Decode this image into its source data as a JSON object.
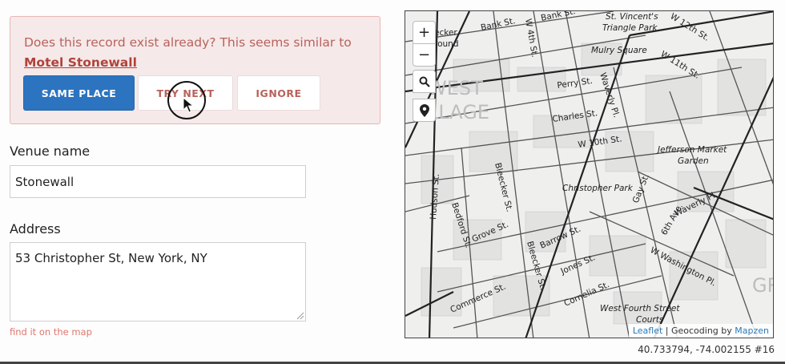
{
  "duplicate_notice": {
    "message": "Does this record exist already? This seems similar to",
    "match_name": "Motel Stonewall"
  },
  "actions": {
    "same_place": "SAME PLACE",
    "try_next": "TRY NEXT",
    "ignore": "IGNORE"
  },
  "form": {
    "venue_label": "Venue name",
    "venue_value": "Stonewall",
    "address_label": "Address",
    "address_value": "53 Christopher St, New York, NY",
    "map_hint": "find it on the map"
  },
  "map": {
    "zoom_in": "+",
    "zoom_out": "−",
    "search_icon": "search-icon",
    "locate_icon": "map-marker-icon",
    "attribution": {
      "leaflet": "Leaflet",
      "separator": " | Geocoding by ",
      "provider": "Mapzen"
    },
    "labels": {
      "bank_st_1": "Bank St.",
      "bank_st_2": "Bank St.",
      "bleecker_top": "ecker",
      "bleecker_top2": "round",
      "st_vincent_1": "St. Vincent's",
      "st_vincent_2": "Triangle Park",
      "w12": "W 12th St.",
      "w11": "W 11th St.",
      "mulry": "Mulry Square",
      "w4": "W 4th St.",
      "perry": "Perry St.",
      "waverly_top": "Waverly Pl.",
      "charles": "Charles St.",
      "w10": "W 10th St.",
      "jefferson_1": "Jefferson Market",
      "jefferson_2": "Garden",
      "hudson": "Hudson St.",
      "bleecker_mid": "Bleecker St.",
      "christopher_park": "Christopher Park",
      "gay": "Gay St.",
      "sixth": "6th Ave.",
      "bedford": "Bedford St.",
      "grove": "Grove St.",
      "barrow": "Barrow St.",
      "bleecker_low": "Bleecker St.",
      "waverly_low": "Waverly Pl.",
      "w_washington": "W Washington Pl.",
      "jones": "Jones St.",
      "commerce": "Commerce St.",
      "cornelia": "Cornelia St.",
      "w_fourth_courts_1": "West Fourth Street",
      "w_fourth_courts_2": "Courts",
      "district_1": "WEST",
      "district_2": "LLAGE",
      "district_gr": "GR"
    }
  },
  "status": {
    "coords": "40.733794, -74.002155 #16"
  },
  "colors": {
    "primary": "#2c74bf",
    "warning_text": "#b8625c",
    "warning_bg": "#f6e9e9",
    "warning_border": "#e8b7b5",
    "hint": "#e0766e"
  }
}
